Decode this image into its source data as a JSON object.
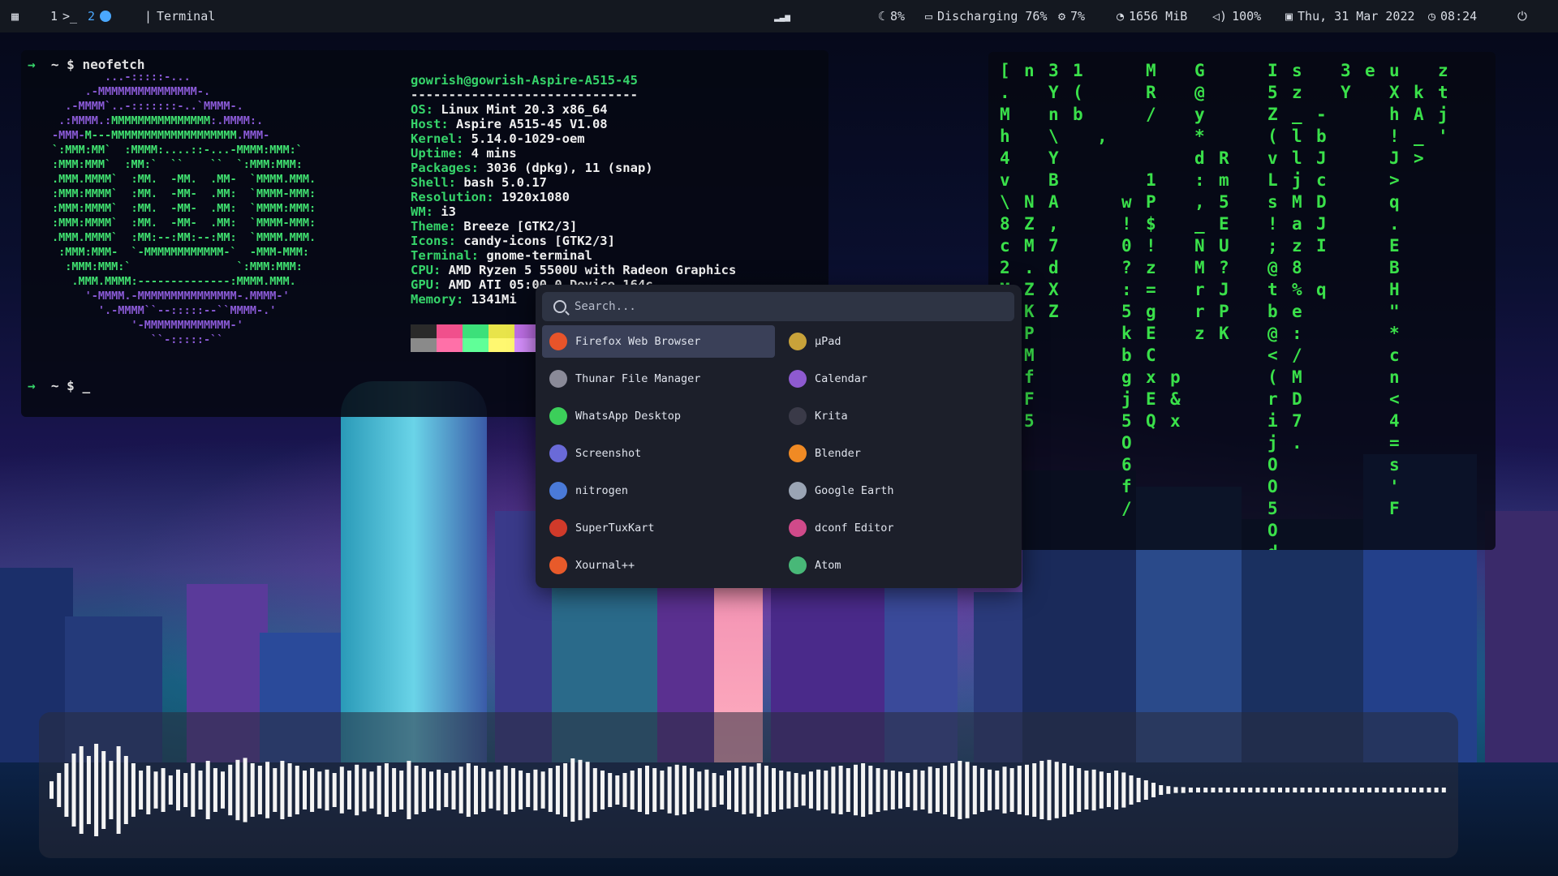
{
  "topbar": {
    "workspace1": "1",
    "workspace1_icon": ">_",
    "workspace2": "2",
    "window_title": "Terminal",
    "cpu": "8%",
    "battery": "Discharging 76%",
    "gpu": "7%",
    "memory": "1656 MiB",
    "volume": "100%",
    "date": "Thu, 31 Mar 2022",
    "time": "08:24",
    "icons": [
      "grid-icon",
      "firefox-icon",
      "signal-icon",
      "moon-icon",
      "battery-icon",
      "cpu-icon",
      "memory-icon",
      "volume-icon",
      "calendar-icon",
      "clock-icon",
      "power-icon"
    ]
  },
  "terminal": {
    "prompt1": "~ $ neofetch",
    "prompt2": "~ $ _",
    "user_host": "gowrish@gowrish-Aspire-A515-45",
    "separator": "------------------------------",
    "info": [
      {
        "k": "OS",
        "v": "Linux Mint 20.3 x86_64"
      },
      {
        "k": "Host",
        "v": "Aspire A515-45 V1.08"
      },
      {
        "k": "Kernel",
        "v": "5.14.0-1029-oem"
      },
      {
        "k": "Uptime",
        "v": "4 mins"
      },
      {
        "k": "Packages",
        "v": "3036 (dpkg), 11 (snap)"
      },
      {
        "k": "Shell",
        "v": "bash 5.0.17"
      },
      {
        "k": "Resolution",
        "v": "1920x1080"
      },
      {
        "k": "WM",
        "v": "i3"
      },
      {
        "k": "Theme",
        "v": "Breeze [GTK2/3]"
      },
      {
        "k": "Icons",
        "v": "candy-icons [GTK2/3]"
      },
      {
        "k": "Terminal",
        "v": "gnome-terminal"
      },
      {
        "k": "CPU",
        "v": "AMD Ryzen 5 5500U with Radeon Graphics"
      },
      {
        "k": "GPU",
        "v": "AMD ATI 05:00.0 Device 164c"
      },
      {
        "k": "Memory",
        "v": "1341Mi"
      }
    ],
    "swatch_colors_top": [
      "#2a2a2a",
      "#f0508c",
      "#3ce07a",
      "#e8e44a",
      "#c070e8",
      "#2a2a2a"
    ],
    "swatch_colors_bottom": [
      "#8a8a8a",
      "#ff70a8",
      "#60ff98",
      "#fff870",
      "#d890ff",
      "#8a8a8a"
    ]
  },
  "launcher": {
    "search_placeholder": "Search...",
    "apps": [
      {
        "name": "Firefox Web Browser",
        "icon": "firefox-icon",
        "color": "#e8542a",
        "selected": true
      },
      {
        "name": "µPad",
        "icon": "upad-icon",
        "color": "#c8a23a"
      },
      {
        "name": "Thunar File Manager",
        "icon": "thunar-icon",
        "color": "#8a8a98"
      },
      {
        "name": "Calendar",
        "icon": "calendar-icon",
        "color": "#8e5ad0"
      },
      {
        "name": "WhatsApp Desktop",
        "icon": "whatsapp-icon",
        "color": "#3ccf5a"
      },
      {
        "name": "Krita",
        "icon": "krita-icon",
        "color": "#3a3a48"
      },
      {
        "name": "Screenshot",
        "icon": "screenshot-icon",
        "color": "#6a6ad8"
      },
      {
        "name": "Blender",
        "icon": "blender-icon",
        "color": "#f08a24"
      },
      {
        "name": "nitrogen",
        "icon": "nitrogen-icon",
        "color": "#4a7ad8"
      },
      {
        "name": "Google Earth",
        "icon": "google-earth-icon",
        "color": "#9aa4b4"
      },
      {
        "name": "SuperTuxKart",
        "icon": "supertuxkart-icon",
        "color": "#d03a2a"
      },
      {
        "name": "dconf Editor",
        "icon": "dconf-editor-icon",
        "color": "#d04a8a"
      },
      {
        "name": "Xournal++",
        "icon": "xournal-icon",
        "color": "#e85a2a"
      },
      {
        "name": "Atom",
        "icon": "atom-icon",
        "color": "#48b878"
      }
    ]
  },
  "matrix": {
    "columns": [
      "[.Mh4v\\8c2M;F'9jsb:%C",
      "n     NZM.ZKPMfF5",
      "3Yn\\YBA,7dXZ",
      "1(b",
      "   ,    ",
      "      w!0?:5kbgj5O6f/",
      "MR/  1P$!z=gECxEQ",
      "              p&x",
      "G@y*d:,_NMrrz",
      "    Rm5EU?JPK",
      " ",
      "I5Z(vLs!;@tb@<(rijOO5Od",
      "sz_lljMaz8%e:/MD7.",
      "  -bJcDJI q",
      "3Y ",
      "e",
      "uXh!J>q.EBH\"*cn<4=s'F",
      " kA_> ",
      "ztj'"
    ]
  },
  "visualizer": {
    "levels": [
      0.18,
      0.35,
      0.55,
      0.75,
      0.9,
      0.7,
      0.95,
      0.8,
      0.6,
      0.9,
      0.7,
      0.55,
      0.4,
      0.5,
      0.38,
      0.45,
      0.3,
      0.42,
      0.35,
      0.55,
      0.4,
      0.6,
      0.45,
      0.38,
      0.52,
      0.62,
      0.66,
      0.55,
      0.5,
      0.58,
      0.45,
      0.6,
      0.55,
      0.5,
      0.4,
      0.45,
      0.38,
      0.42,
      0.35,
      0.48,
      0.4,
      0.52,
      0.44,
      0.38,
      0.5,
      0.55,
      0.45,
      0.4,
      0.6,
      0.5,
      0.45,
      0.38,
      0.42,
      0.35,
      0.4,
      0.48,
      0.55,
      0.5,
      0.45,
      0.38,
      0.42,
      0.5,
      0.45,
      0.4,
      0.35,
      0.42,
      0.38,
      0.45,
      0.5,
      0.55,
      0.65,
      0.62,
      0.58,
      0.45,
      0.4,
      0.35,
      0.3,
      0.35,
      0.4,
      0.45,
      0.5,
      0.45,
      0.4,
      0.48,
      0.52,
      0.5,
      0.45,
      0.38,
      0.42,
      0.35,
      0.3,
      0.4,
      0.45,
      0.5,
      0.48,
      0.55,
      0.5,
      0.45,
      0.4,
      0.38,
      0.35,
      0.32,
      0.38,
      0.42,
      0.4,
      0.48,
      0.5,
      0.45,
      0.52,
      0.55,
      0.5,
      0.45,
      0.42,
      0.4,
      0.38,
      0.35,
      0.42,
      0.4,
      0.48,
      0.45,
      0.5,
      0.55,
      0.6,
      0.58,
      0.5,
      0.45,
      0.42,
      0.4,
      0.48,
      0.45,
      0.5,
      0.52,
      0.55,
      0.6,
      0.62,
      0.58,
      0.55,
      0.5,
      0.45,
      0.4,
      0.42,
      0.38,
      0.35,
      0.4,
      0.36,
      0.3,
      0.25,
      0.2,
      0.15,
      0.1,
      0.08,
      0.06,
      0.06,
      0.05,
      0.05,
      0.05,
      0.05,
      0.05,
      0.05,
      0.05,
      0.05,
      0.05,
      0.05,
      0.05,
      0.05,
      0.05,
      0.05,
      0.05,
      0.05,
      0.05,
      0.05,
      0.05,
      0.05,
      0.05,
      0.05,
      0.05,
      0.05,
      0.05,
      0.05,
      0.05,
      0.05,
      0.05,
      0.05,
      0.05,
      0.05,
      0.05,
      0.05,
      0.05
    ]
  }
}
